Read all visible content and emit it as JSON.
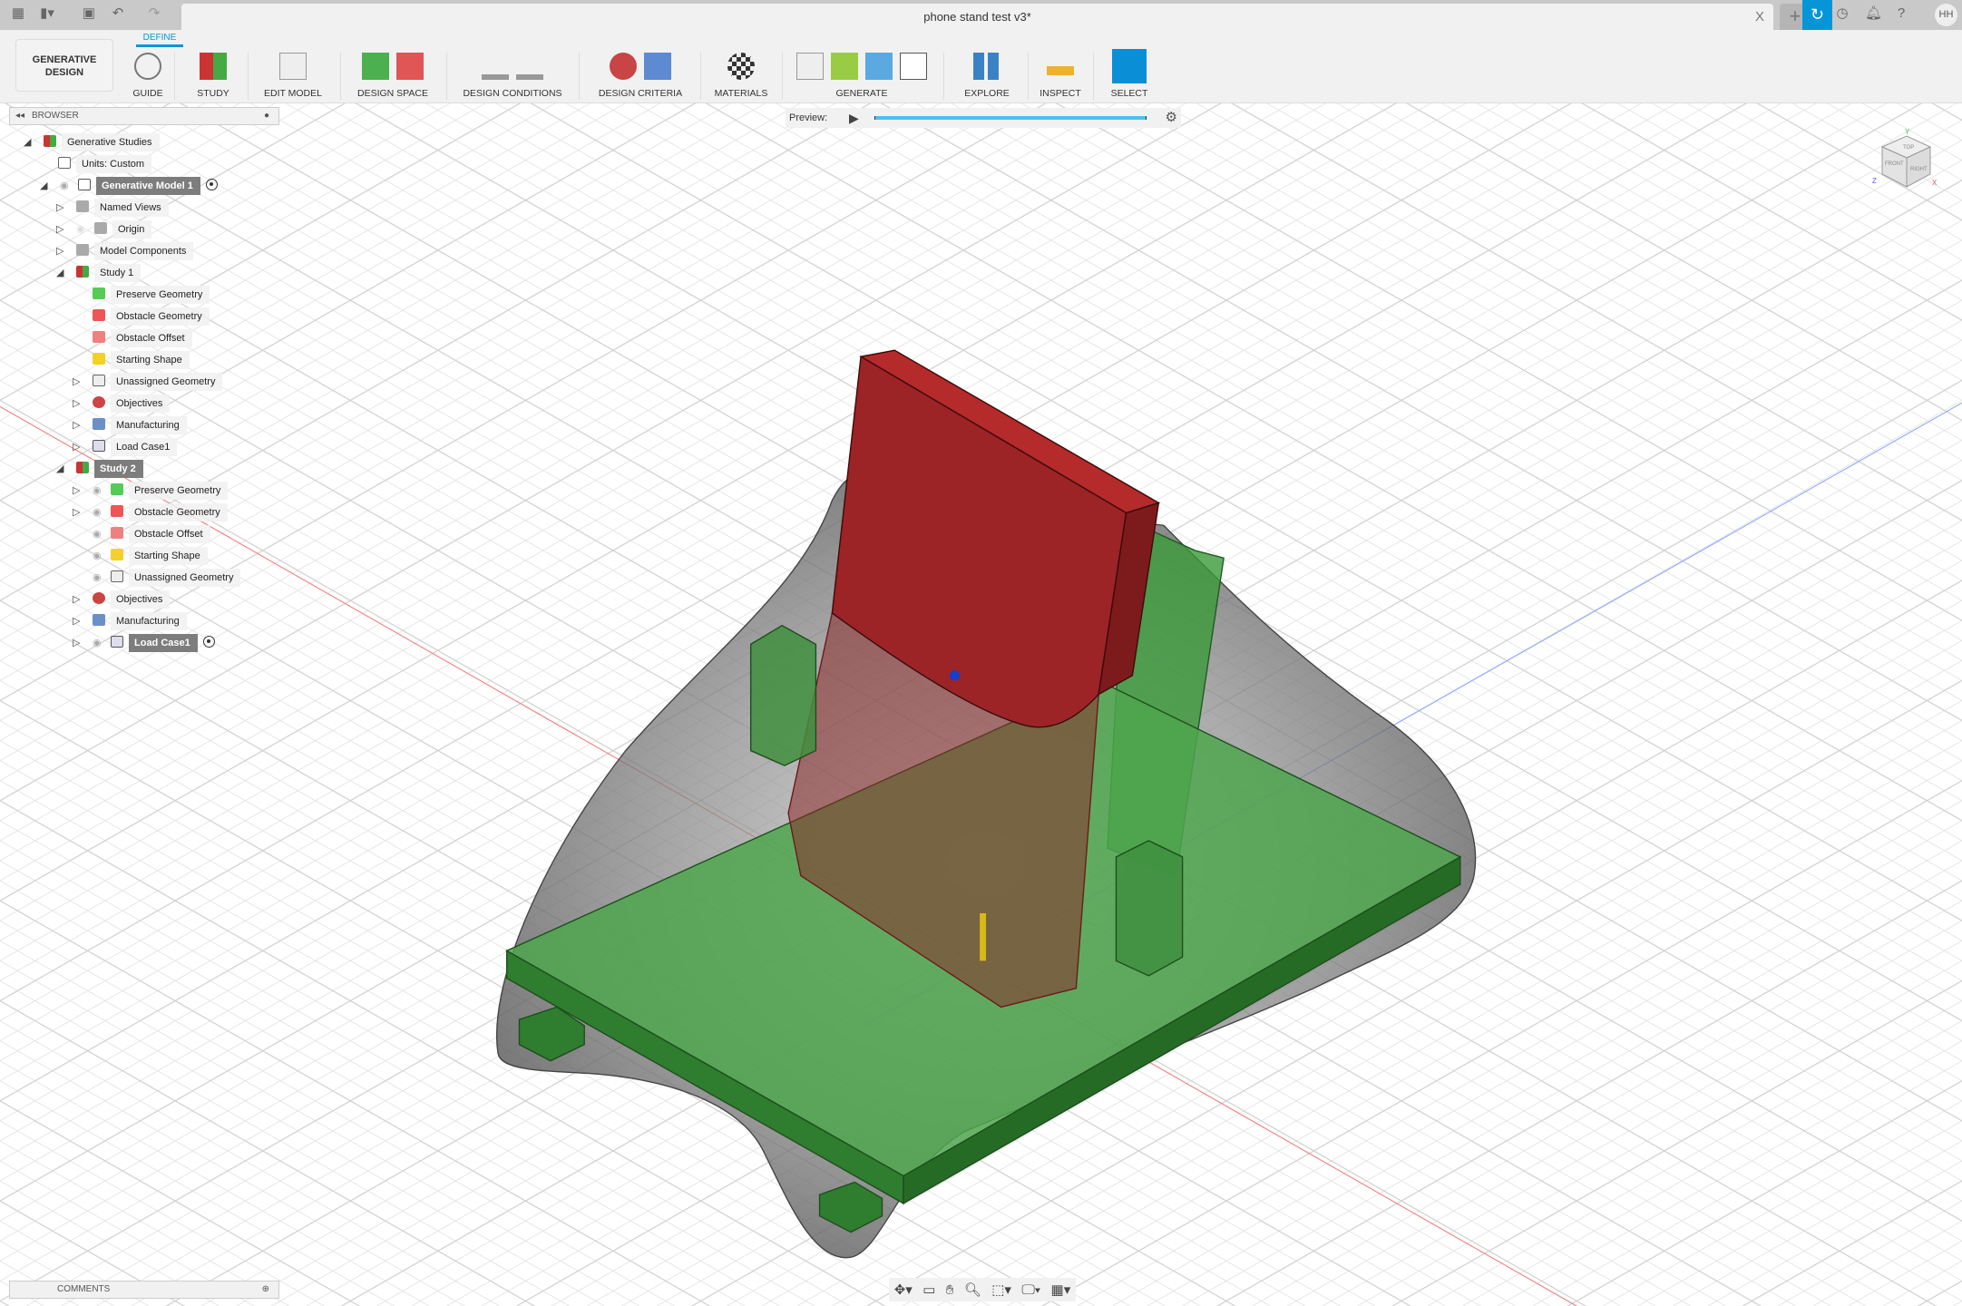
{
  "titlebar": {
    "document_title": "phone stand test v3*",
    "close": "X",
    "new_tab": "+",
    "user_initials": "HH",
    "icons": [
      "apps-grid-icon",
      "file-icon",
      "save-icon",
      "undo-icon",
      "redo-icon",
      "cloud-sync-icon",
      "clock-icon",
      "bell-icon",
      "help-icon"
    ]
  },
  "toolbar": {
    "workspace": "GENERATIVE DESIGN",
    "active_tab": "DEFINE",
    "groups": [
      {
        "label": "GUIDE"
      },
      {
        "label": "STUDY"
      },
      {
        "label": "EDIT MODEL"
      },
      {
        "label": "DESIGN SPACE"
      },
      {
        "label": "DESIGN CONDITIONS"
      },
      {
        "label": "DESIGN CRITERIA"
      },
      {
        "label": "MATERIALS"
      },
      {
        "label": "GENERATE"
      },
      {
        "label": "EXPLORE"
      },
      {
        "label": "INSPECT"
      },
      {
        "label": "SELECT"
      }
    ]
  },
  "browser": {
    "title": "BROWSER",
    "items": [
      {
        "label": "Generative Studies"
      },
      {
        "label": "Units: Custom"
      },
      {
        "label": "Generative Model 1"
      },
      {
        "label": "Named Views"
      },
      {
        "label": "Origin"
      },
      {
        "label": "Model Components"
      },
      {
        "label": "Study 1"
      },
      {
        "label": "Preserve Geometry"
      },
      {
        "label": "Obstacle Geometry"
      },
      {
        "label": "Obstacle Offset"
      },
      {
        "label": "Starting Shape"
      },
      {
        "label": "Unassigned Geometry"
      },
      {
        "label": "Objectives"
      },
      {
        "label": "Manufacturing"
      },
      {
        "label": "Load Case1"
      },
      {
        "label": "Study 2"
      },
      {
        "label": "Preserve Geometry"
      },
      {
        "label": "Obstacle Geometry"
      },
      {
        "label": "Obstacle Offset"
      },
      {
        "label": "Starting Shape"
      },
      {
        "label": "Unassigned Geometry"
      },
      {
        "label": "Objectives"
      },
      {
        "label": "Manufacturing"
      },
      {
        "label": "Load Case1"
      }
    ]
  },
  "preview": {
    "label": "Preview:",
    "progress": 1.0
  },
  "comments": {
    "title": "COMMENTS"
  },
  "viewcube": {
    "top": "TOP",
    "front": "FRONT",
    "right": "RIGHT",
    "x": "X",
    "y": "Y",
    "z": "Z"
  },
  "colors": {
    "accent": "#0696d7",
    "preserve": "#2e8b2e",
    "obstacle": "#a52125",
    "grid": "#d9d9d9"
  }
}
